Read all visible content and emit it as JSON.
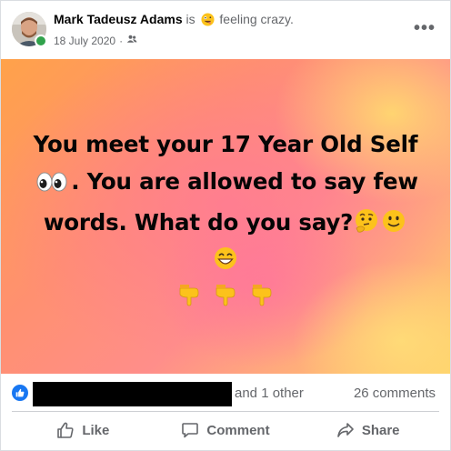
{
  "author": {
    "name": "Mark Tadeusz Adams",
    "is_word": "is",
    "feeling_icon": "crazy-face-emoji",
    "feeling": "feeling crazy.",
    "date": "18 July 2020",
    "separator": "·",
    "audience_icon": "friends-icon",
    "online": true
  },
  "header": {
    "more_icon": "more-options-icon",
    "more_label": "•••"
  },
  "post": {
    "line1": "You meet your 17 Year Old Self",
    "line2_after_emoji": ". You are allowed to say few",
    "line3": "words. What do you say?",
    "emojis": [
      "eyes-emoji",
      "thinking-face-emoji",
      "slightly-smiling-face-emoji",
      "grinning-face-emoji",
      "pointing-down-emoji",
      "pointing-down-emoji",
      "pointing-down-emoji"
    ],
    "background_colors": [
      "#ffa24a",
      "#ff8e8a",
      "#ffd06a"
    ]
  },
  "stats": {
    "reaction_icon": "like-reaction-icon",
    "others_text": "and 1 other",
    "comments_text": "26 comments"
  },
  "actions": {
    "like_label": "Like",
    "comment_label": "Comment",
    "share_label": "Share"
  },
  "colors": {
    "accent": "#1877f2",
    "muted_text": "#65676b",
    "online": "#31a24c"
  }
}
